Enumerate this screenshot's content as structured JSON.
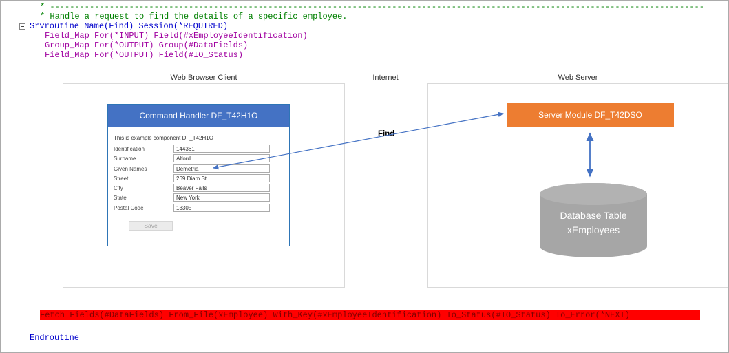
{
  "code": {
    "line1": "* ------------------------------------------------------------------------------------------------------------------------------------",
    "line2": "* Handle a request to find the details of a specific employee.",
    "line3": "Srvroutine Name(Find) Session(*REQUIRED)",
    "line4": "Field_Map For(*INPUT) Field(#xEmployeeIdentification)",
    "line5": "Group_Map For(*OUTPUT) Group(#DataFields)",
    "line6": "Field_Map For(*OUTPUT) Field(#IO_Status)",
    "fetch_line": "Fetch Fields(#DataFields) From_File(xEmployee) With_Key(#xEmployeeIdentification) Io_Status(#IO_Status) Io_Error(*NEXT)",
    "endroutine": "Endroutine"
  },
  "diagram": {
    "browser_title": "Web  Browser Client",
    "internet_title": "Internet",
    "server_title": "Web Server",
    "find_label": "Find",
    "form": {
      "header": "Command Handler DF_T42H1O",
      "description": "This is example component DF_T42H1O",
      "fields": [
        {
          "label": "Identification",
          "value": "144361"
        },
        {
          "label": "Surname",
          "value": "Alford"
        },
        {
          "label": "Given Names",
          "value": "Demetria"
        },
        {
          "label": "Street",
          "value": "269 Diam St."
        },
        {
          "label": "City",
          "value": "Beaver Falls"
        },
        {
          "label": "State",
          "value": "New York"
        },
        {
          "label": "Postal Code",
          "value": "13305"
        }
      ],
      "save_button": "Save"
    },
    "server_module": "Server Module DF_T42DSO",
    "database_line1": "Database Table",
    "database_line2": "xEmployees"
  },
  "colors": {
    "comment_green": "#008000",
    "keyword_blue": "#0000CC",
    "command_purple": "#A000A0",
    "breakpoint_bg": "#FF0000",
    "breakpoint_text": "#800000",
    "accent_blue": "#4472C4",
    "server_orange": "#ED7D31",
    "database_gray": "#A6A6A6"
  }
}
